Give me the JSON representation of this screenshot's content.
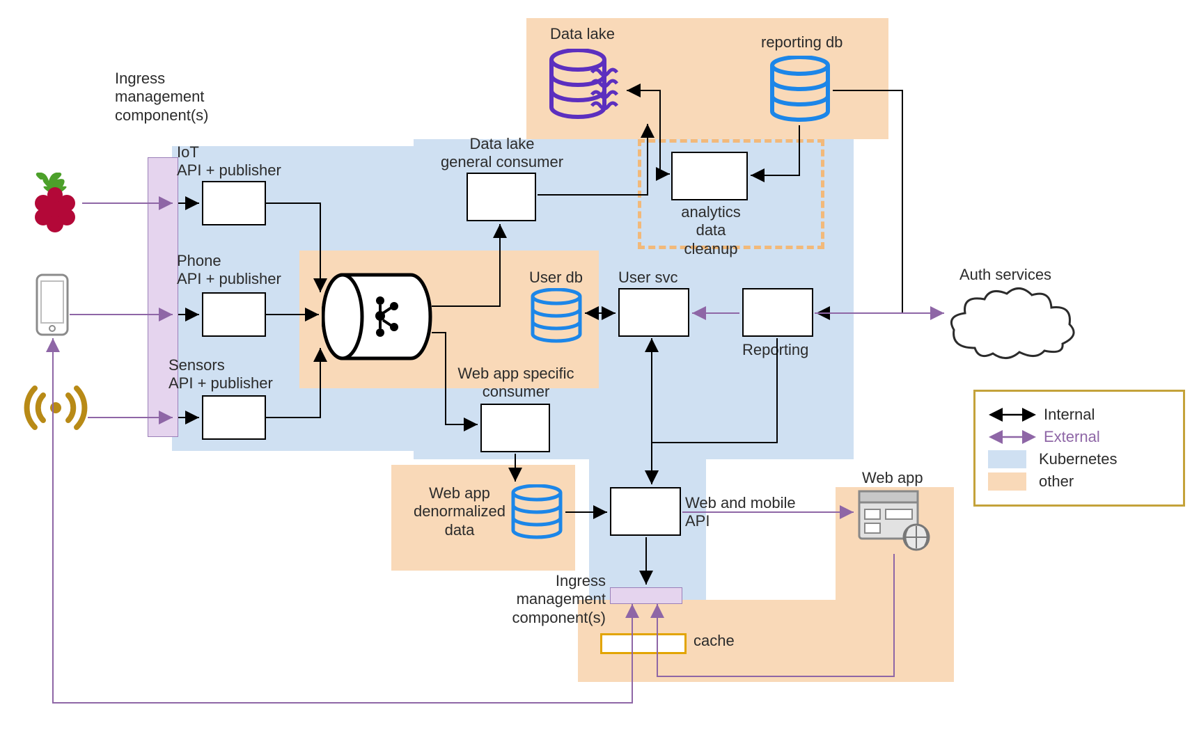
{
  "labels": {
    "ingress_left": "Ingress\nmanagement\ncomponent(s)",
    "iot": "IoT\nAPI + publisher",
    "phone": "Phone\nAPI + publisher",
    "sensors": "Sensors\nAPI + publisher",
    "data_lake": "Data lake",
    "data_lake_consumer": "Data lake\ngeneral consumer",
    "reporting_db": "reporting db",
    "analytics_cleanup": "analytics data\ncleanup",
    "user_db": "User db",
    "user_svc": "User svc",
    "reporting": "Reporting",
    "webapp_consumer": "Web app specific\nconsumer",
    "webapp_denorm": "Web app\ndenormalized\ndata",
    "web_mobile_api": "Web and mobile\nAPI",
    "ingress_bottom": "Ingress\nmanagement\ncomponent(s)",
    "cache": "cache",
    "web_app": "Web app",
    "auth": "Auth services"
  },
  "legend": {
    "internal": "Internal",
    "external": "External",
    "kubernetes": "Kubernetes",
    "other": "other"
  },
  "colors": {
    "kubernetes": "#CFE0F2",
    "other": "#F9D9B8",
    "internal_arrow": "#000000",
    "external_arrow": "#8E66A6",
    "db_blue": "#1C86E8",
    "db_purple": "#5C2FBF",
    "gold": "#C4A23A",
    "ingress_fill": "#E5D4EE"
  }
}
